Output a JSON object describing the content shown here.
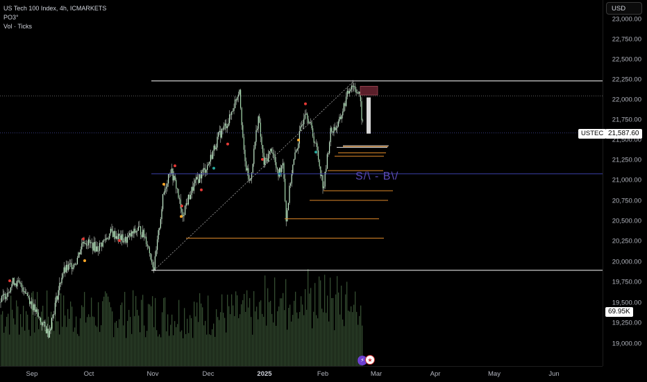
{
  "legend": {
    "title": "US Tech 100 Index, 4h, ICMARKETS",
    "indicator1": "PO3°",
    "indicator2": "Vol · Ticks"
  },
  "currency_button": "USD",
  "y_axis_ticks": [
    "23,000.00",
    "22,750.00",
    "22,500.00",
    "22,250.00",
    "22,000.00",
    "21,750.00",
    "21,500.00",
    "21,250.00",
    "21,000.00",
    "20,750.00",
    "20,500.00",
    "20,250.00",
    "20,000.00",
    "19,750.00",
    "19,500.00",
    "19,250.00",
    "19,000.00"
  ],
  "x_axis_ticks": [
    "Sep",
    "Oct",
    "Nov",
    "Dec",
    "2025",
    "Feb",
    "Mar",
    "Apr",
    "May",
    "Jun"
  ],
  "symbol_badge": "USTEC",
  "last_price": "21,587.60",
  "volume_badge": "69.95K",
  "annotation": "S/\\  -  B\\/",
  "event_icons": [
    "lightning-icon",
    "us-flag-icon"
  ],
  "colors": {
    "background": "#000000",
    "candle": "#e8f5e9",
    "volume": "#3d5a3a",
    "orange_level": "#e08a2a",
    "white_level": "#ffffff",
    "blue_line": "#3b3fa8",
    "annotation": "#5c4bb8"
  }
}
